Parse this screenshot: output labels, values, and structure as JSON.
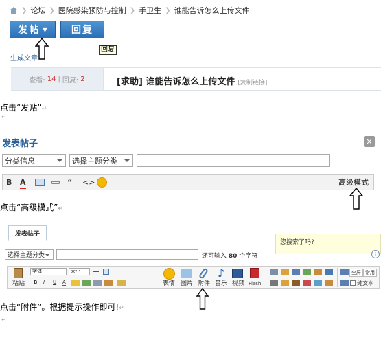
{
  "breadcrumb": [
    "论坛",
    "医院感染预防与控制",
    "手卫生",
    "谁能告诉怎么上传文件"
  ],
  "post_button": {
    "label": "发帖"
  },
  "reply_button": {
    "label": "回复"
  },
  "tooltip": "回复",
  "generate_link": "生成文章",
  "stats": {
    "views_label": "查看:",
    "views": "14",
    "sep": "|",
    "replies_label": "回复:",
    "replies": "2"
  },
  "post_title": "[求助] 谁能告诉怎么上传文件",
  "copy_link": "[复制链接]",
  "captions": {
    "step1": "点击“发贴”",
    "step2": "点击“高级模式”",
    "step3": "点击“附件”。根据提示操作即可!"
  },
  "return_mark": "↵",
  "compose": {
    "title": "发表帖子",
    "close": "✕",
    "category": "分类信息",
    "topic": "选择主题分类",
    "toolbar": {
      "bold": "B",
      "color": "A",
      "quote": "“",
      "code": "<>"
    },
    "advanced": "高级模式"
  },
  "advanced_editor": {
    "tab": "发表帖子",
    "search_tip": "您搜索了吗?",
    "info": "i",
    "topic": "选择主题分类",
    "limit_prefix": "还可输入",
    "limit_count": "80",
    "limit_suffix": "个字符",
    "font": "字体",
    "size": "大小",
    "paste": "粘贴",
    "buttons": [
      "表情",
      "图片",
      "附件",
      "音乐",
      "视频",
      "Flash"
    ],
    "fullscreen": "全屏",
    "common": "常用",
    "plain_text": "纯文本",
    "fmt": {
      "b": "B",
      "i": "I",
      "u": "U",
      "a": "A"
    }
  },
  "colors": {
    "accent": "#2b6fb6",
    "link": "#2b5f99",
    "count": "#cc3333"
  }
}
